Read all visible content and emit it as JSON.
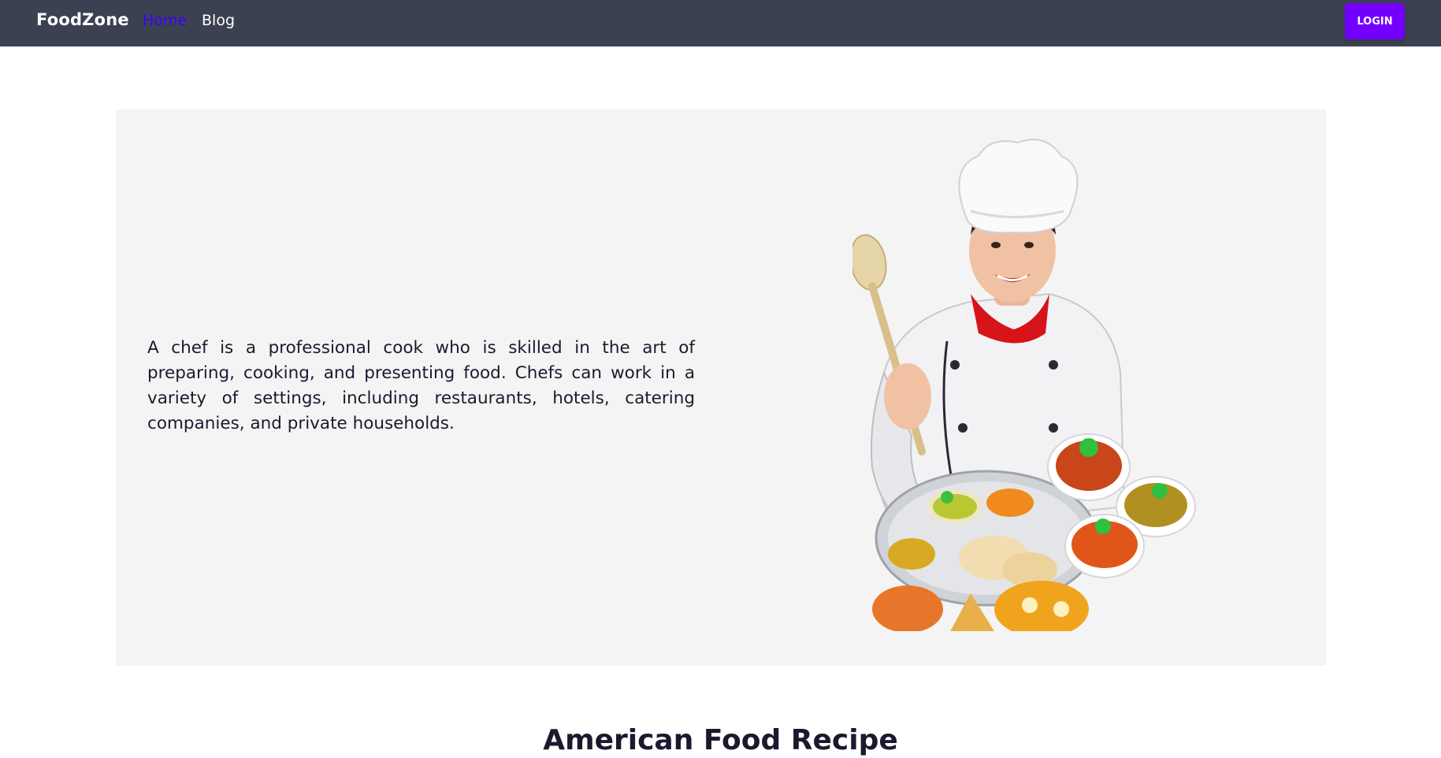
{
  "navbar": {
    "brand": "FoodZone",
    "links": [
      {
        "label": "Home",
        "active": true
      },
      {
        "label": "Blog",
        "active": false
      }
    ],
    "login_label": "LOGIN",
    "colors": {
      "background": "#3b4151",
      "active_link": "#3f00ff",
      "login_button": "#7300ff"
    }
  },
  "hero": {
    "description": "A chef is a professional cook who is skilled in the art of preparing, cooking, and presenting food. Chefs can work in a variety of settings, including restaurants, hotels, catering companies, and private households.",
    "background_color": "#f4f4f4"
  },
  "section": {
    "title": "American Food Recipe"
  }
}
